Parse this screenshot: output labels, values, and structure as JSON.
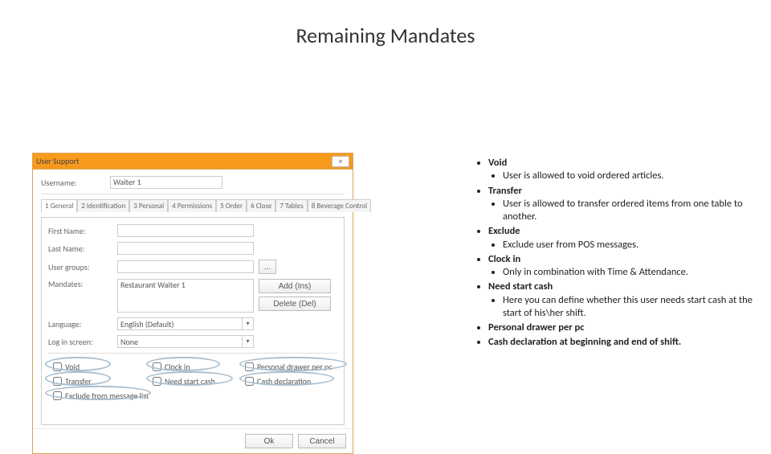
{
  "title": "Remaining Mandates",
  "bullets": [
    {
      "label": "Void",
      "sub": [
        "User is allowed to void ordered articles."
      ]
    },
    {
      "label": "Transfer",
      "sub": [
        "User is allowed to transfer ordered items from one table to another."
      ]
    },
    {
      "label": "Exclude",
      "sub": [
        "Exclude user from POS messages."
      ]
    },
    {
      "label": "Clock in",
      "sub": [
        "Only in combination with Time & Attendance."
      ]
    },
    {
      "label": "Need start cash",
      "sub": [
        "Here you can define whether this user needs start cash at the start of his\\her shift."
      ]
    },
    {
      "label": "Personal drawer per pc",
      "sub": []
    },
    {
      "label": "Cash declaration at beginning and end of shift.",
      "sub": []
    }
  ],
  "dialog": {
    "title": "User Support",
    "close": "×",
    "username_label": "Username:",
    "username_value": "Waiter 1",
    "tabs": [
      "1 General",
      "2 Identification",
      "3 Personal",
      "4 Permissions",
      "5 Order",
      "6 Close",
      "7 Tables",
      "8 Beverage Control"
    ],
    "firstname_label": "First Name:",
    "lastname_label": "Last Name:",
    "usergroups_label": "User groups:",
    "ellipsis": "...",
    "mandates_label": "Mandates:",
    "mandates_value": "Restaurant Waiter 1",
    "add_btn": "Add (Ins)",
    "del_btn": "Delete (Del)",
    "language_label": "Language:",
    "language_value": "English (Default)",
    "loginscreen_label": "Log in screen:",
    "loginscreen_value": "None",
    "checks": {
      "void": "Void",
      "transfer": "Transfer",
      "exclude": "Exclude from message list",
      "clockin": "Clock in",
      "needstart": "Need start cash",
      "personal": "Personal drawer per pc",
      "cashdecl": "Cash declaration"
    },
    "ok": "Ok",
    "cancel": "Cancel"
  }
}
